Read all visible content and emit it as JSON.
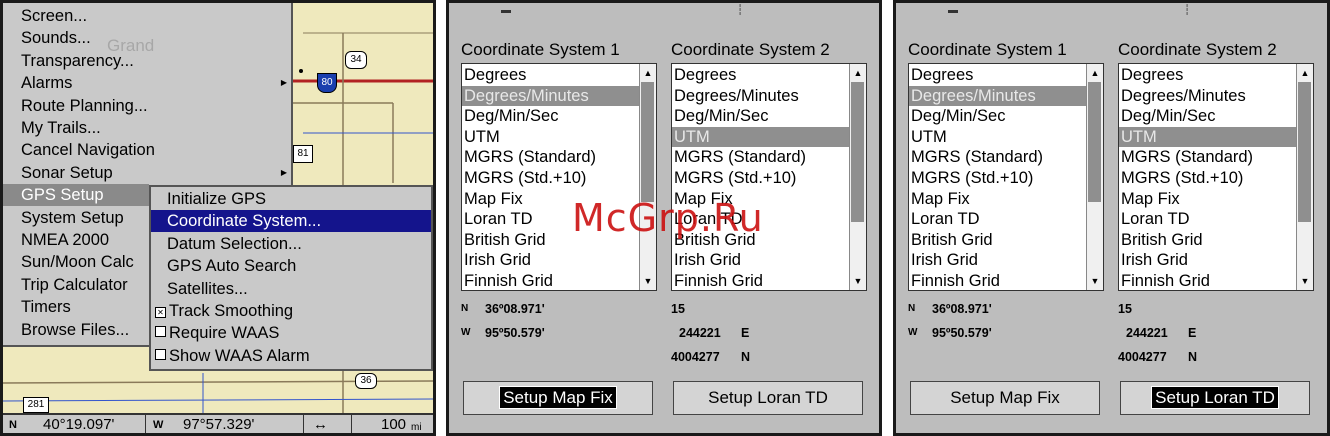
{
  "panel1": {
    "menu_items": [
      {
        "label": "Screen...",
        "submenu": false,
        "selected": false
      },
      {
        "label": "Sounds...",
        "submenu": false,
        "selected": false
      },
      {
        "label": "Transparency...",
        "submenu": false,
        "selected": false
      },
      {
        "label": "Alarms",
        "submenu": true,
        "selected": false
      },
      {
        "label": "Route Planning...",
        "submenu": false,
        "selected": false
      },
      {
        "label": "My Trails...",
        "submenu": false,
        "selected": false
      },
      {
        "label": "Cancel Navigation",
        "submenu": false,
        "selected": false
      },
      {
        "label": "Sonar Setup",
        "submenu": true,
        "selected": false
      },
      {
        "label": "GPS Setup",
        "submenu": false,
        "selected": true
      },
      {
        "label": "System Setup",
        "submenu": false,
        "selected": false
      },
      {
        "label": "NMEA 2000",
        "submenu": false,
        "selected": false
      },
      {
        "label": "Sun/Moon Calc",
        "submenu": false,
        "selected": false
      },
      {
        "label": "Trip Calculator",
        "submenu": false,
        "selected": false
      },
      {
        "label": "Timers",
        "submenu": false,
        "selected": false
      },
      {
        "label": "Browse Files...",
        "submenu": false,
        "selected": false
      }
    ],
    "submenu_items": [
      {
        "label": "Initialize GPS",
        "checkbox": null,
        "selected": false
      },
      {
        "label": "Coordinate System...",
        "checkbox": null,
        "selected": true
      },
      {
        "label": "Datum Selection...",
        "checkbox": null,
        "selected": false
      },
      {
        "label": "GPS Auto Search",
        "checkbox": null,
        "selected": false
      },
      {
        "label": "Satellites...",
        "checkbox": null,
        "selected": false
      },
      {
        "label": "Track Smoothing",
        "checkbox": true,
        "selected": false
      },
      {
        "label": "Require WAAS",
        "checkbox": false,
        "selected": false
      },
      {
        "label": "Show WAAS Alarm",
        "checkbox": false,
        "selected": false
      }
    ],
    "map": {
      "road_shields": [
        "34",
        "80",
        "81",
        "36",
        "281"
      ],
      "town_label": "Grand"
    },
    "status": {
      "lat_prefix": "N",
      "lat": "40°19.097'",
      "lon_prefix": "W",
      "lon": "97°57.329'",
      "zoom_icon": "↔",
      "zoom": "100",
      "zoom_unit": "mi"
    }
  },
  "coord_dialogs": [
    {
      "title1": "Coordinate System 1",
      "title2": "Coordinate System 2",
      "options": [
        "Degrees",
        "Degrees/Minutes",
        "Deg/Min/Sec",
        "UTM",
        "MGRS (Standard)",
        "MGRS (Std.+10)",
        "Map Fix",
        "Loran TD",
        "British Grid",
        "Irish Grid",
        "Finnish Grid"
      ],
      "selected1": 1,
      "selected2": 3,
      "left_coord": {
        "n_prefix": "N",
        "n": "36º08.971'",
        "w_prefix": "W",
        "w": "95º50.579'"
      },
      "right_coord": {
        "zone": "15",
        "easting": "244221",
        "e_suffix": "E",
        "northing": "4004277",
        "n_suffix": "N"
      },
      "button1": "Setup Map Fix",
      "button2": "Setup Loran TD",
      "active_button": 1
    },
    {
      "title1": "Coordinate System 1",
      "title2": "Coordinate System 2",
      "options": [
        "Degrees",
        "Degrees/Minutes",
        "Deg/Min/Sec",
        "UTM",
        "MGRS (Standard)",
        "MGRS (Std.+10)",
        "Map Fix",
        "Loran TD",
        "British Grid",
        "Irish Grid",
        "Finnish Grid"
      ],
      "selected1": 1,
      "selected2": 3,
      "left_coord": {
        "n_prefix": "N",
        "n": "36º08.971'",
        "w_prefix": "W",
        "w": "95º50.579'"
      },
      "right_coord": {
        "zone": "15",
        "easting": "244221",
        "e_suffix": "E",
        "northing": "4004277",
        "n_suffix": "N"
      },
      "button1": "Setup Map Fix",
      "button2": "Setup Loran TD",
      "active_button": 2
    }
  ],
  "watermark": "McGrp.Ru",
  "colors": {
    "menu_highlight": "#14148c",
    "list_highlight": "#8f8f8f",
    "map_road": "#b22222",
    "map_water": "#3355cc"
  }
}
